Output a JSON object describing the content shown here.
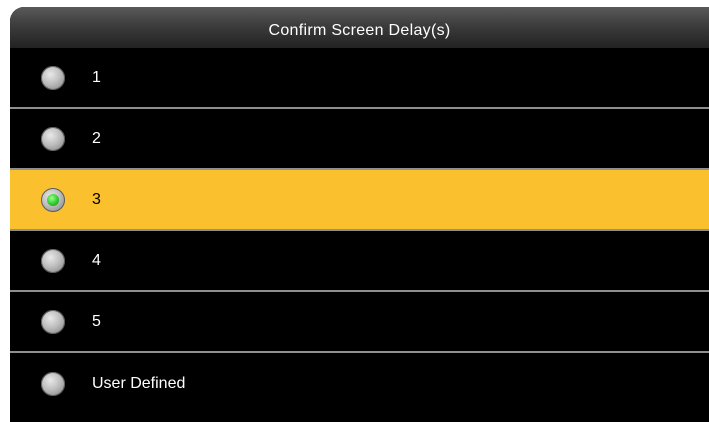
{
  "window": {
    "title": "Confirm Screen Delay(s)"
  },
  "options": [
    {
      "label": "1",
      "selected": false
    },
    {
      "label": "2",
      "selected": false
    },
    {
      "label": "3",
      "selected": true
    },
    {
      "label": "4",
      "selected": false
    },
    {
      "label": "5",
      "selected": false
    },
    {
      "label": "User Defined",
      "selected": false
    }
  ],
  "colors": {
    "background": "#000000",
    "selected_row": "#fbc02d",
    "separator": "#8f8f8f",
    "radio_selected_dot": "#2ecc2e"
  },
  "icons": {
    "radio_off": "radio-unchecked-icon",
    "radio_on": "radio-checked-icon"
  }
}
